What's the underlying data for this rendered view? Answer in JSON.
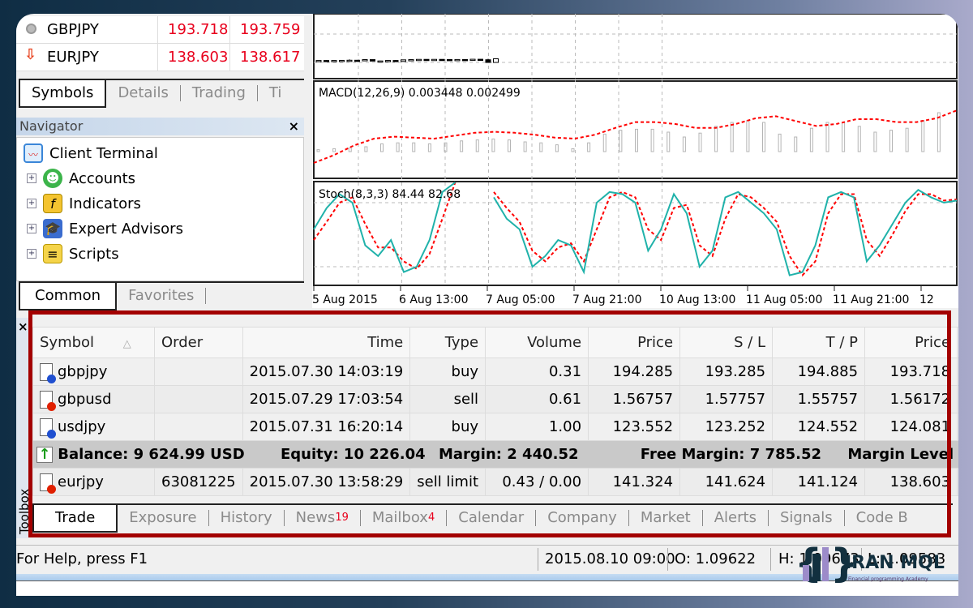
{
  "market_watch": {
    "rows": [
      {
        "symbol": "GBPJPY",
        "bid": "193.718",
        "ask": "193.759",
        "icon": "neutral-circle-icon"
      },
      {
        "symbol": "EURJPY",
        "bid": "138.603",
        "ask": "138.617",
        "icon": "down-arrow-icon"
      }
    ],
    "tabs": [
      "Symbols",
      "Details",
      "Trading",
      "Ti"
    ]
  },
  "navigator": {
    "title": "Navigator",
    "close": "×",
    "root": "Client Terminal",
    "items": [
      "Accounts",
      "Indicators",
      "Expert Advisors",
      "Scripts"
    ],
    "tabs": [
      "Common",
      "Favorites"
    ]
  },
  "chart": {
    "macd_label": "MACD(12,26,9) 0.003448 0.002499",
    "stoch_label": "Stoch(8,3,3) 84.44 82.68",
    "time_labels": [
      "5 Aug 2015",
      "6 Aug 13:00",
      "7 Aug 05:00",
      "7 Aug 21:00",
      "10 Aug 13:00",
      "11 Aug 05:00",
      "11 Aug 21:00",
      "12"
    ],
    "candles": [
      [
        1.0975,
        1.0977,
        1.0973,
        1.0976
      ],
      [
        1.0976,
        1.0978,
        1.0974,
        1.0975
      ],
      [
        1.0975,
        1.0977,
        1.0974,
        1.0976
      ],
      [
        1.0976,
        1.0979,
        1.0975,
        1.0977
      ],
      [
        1.0977,
        1.0985,
        1.0976,
        1.0978
      ],
      [
        1.0978,
        1.0979,
        1.0975,
        1.0977
      ],
      [
        1.0977,
        1.0984,
        1.0976,
        1.0983
      ],
      [
        1.0983,
        1.0984,
        1.097,
        1.0971
      ],
      [
        1.0971,
        1.0974,
        1.0969,
        1.0972
      ],
      [
        1.0972,
        1.0978,
        1.0971,
        1.0976
      ],
      [
        1.0976,
        1.0979,
        1.0967,
        1.0968
      ],
      [
        1.0968,
        1.0982,
        1.0967,
        1.0981
      ],
      [
        1.0981,
        1.0984,
        1.0979,
        1.0983
      ],
      [
        1.0983,
        1.0986,
        1.0981,
        1.0985
      ],
      [
        1.0985,
        1.0987,
        1.0983,
        1.0984
      ],
      [
        1.0984,
        1.0986,
        1.0982,
        1.0985
      ],
      [
        1.0985,
        1.0986,
        1.0983,
        1.0984
      ],
      [
        1.0984,
        1.0986,
        1.0981,
        1.0982
      ],
      [
        1.0982,
        1.0985,
        1.098,
        1.0984
      ],
      [
        1.0984,
        1.0986,
        1.0982,
        1.0983
      ],
      [
        1.0983,
        1.0987,
        1.0982,
        1.0986
      ],
      [
        1.0986,
        1.0987,
        1.0981,
        1.0982
      ],
      [
        1.0982,
        1.099,
        1.0958,
        1.096
      ],
      [
        1.096,
        1.0992,
        1.0959,
        1.099
      ]
    ],
    "macd_hist": [
      0.2,
      0.3,
      0.4,
      0.5,
      0.8,
      0.9,
      0.9,
      0.8,
      0.9,
      1.1,
      1.2,
      1.3,
      1.2,
      1.0,
      0.9,
      0.7,
      0.3,
      0.9,
      1.8,
      2.2,
      2.3,
      2.3,
      2.0,
      1.5,
      1.9,
      2.6,
      3.0,
      3.2,
      3.0,
      1.8,
      1.5,
      2.4,
      3.0,
      3.0,
      2.6,
      2.0,
      2.2,
      2.4,
      3.2,
      4.0
    ],
    "macd_signal": [
      -2.0,
      -1.2,
      -0.2,
      0.5,
      0.7,
      0.6,
      0.5,
      0.8,
      1.1,
      1.2,
      1.1,
      0.9,
      0.6,
      0.5,
      0.9,
      1.6,
      2.2,
      2.2,
      2.0,
      1.6,
      1.6,
      2.0,
      2.6,
      2.8,
      2.3,
      1.8,
      2.0,
      2.5,
      2.5,
      2.2,
      2.2,
      2.6,
      3.4
    ],
    "stoch_main": [
      55,
      75,
      88,
      80,
      40,
      30,
      45,
      15,
      20,
      45,
      90,
      110,
      null,
      null,
      85,
      65,
      55,
      20,
      30,
      45,
      40,
      15,
      80,
      90,
      88,
      80,
      35,
      55,
      88,
      70,
      20,
      35,
      85,
      90,
      80,
      70,
      55,
      12,
      15,
      40,
      85,
      90,
      85,
      25,
      40,
      60,
      80,
      92,
      85,
      80,
      82
    ],
    "stoch_signal": [
      45,
      62,
      80,
      85,
      60,
      38,
      38,
      25,
      18,
      32,
      65,
      100,
      null,
      null,
      90,
      75,
      62,
      35,
      25,
      38,
      42,
      25,
      55,
      85,
      90,
      85,
      55,
      45,
      75,
      78,
      40,
      30,
      65,
      88,
      85,
      75,
      62,
      30,
      12,
      25,
      70,
      88,
      88,
      45,
      30,
      50,
      72,
      88,
      88,
      82,
      83
    ],
    "colors": {
      "stoch_main": "#20b2aa",
      "signal": "#ff0000",
      "macd_hist": "#b4b4b4"
    }
  },
  "toolbox": {
    "label": "Toolbox",
    "close": "×",
    "columns": [
      "Symbol",
      "Order",
      "Time",
      "Type",
      "Volume",
      "Price",
      "S / L",
      "T / P",
      "Price"
    ],
    "rows": [
      {
        "symbol": "gbpjpy",
        "order": "",
        "time": "2015.07.30 14:03:19",
        "type": "buy",
        "volume": "0.31",
        "price": "194.285",
        "sl": "193.285",
        "tp": "194.885",
        "cur": "193.718",
        "dot": "#1f4fd0"
      },
      {
        "symbol": "gbpusd",
        "order": "",
        "time": "2015.07.29 17:03:54",
        "type": "sell",
        "volume": "0.61",
        "price": "1.56757",
        "sl": "1.57757",
        "tp": "1.55757",
        "cur": "1.56172",
        "dot": "#e02000"
      },
      {
        "symbol": "usdjpy",
        "order": "",
        "time": "2015.07.31 16:20:14",
        "type": "buy",
        "volume": "1.00",
        "price": "123.552",
        "sl": "123.252",
        "tp": "124.552",
        "cur": "124.081",
        "dot": "#1f4fd0"
      }
    ],
    "summary": {
      "balance": "Balance: 9 624.99 USD",
      "equity": "Equity: 10 226.04",
      "margin": "Margin: 2 440.52",
      "free_margin": "Free Margin: 7 785.52",
      "margin_level": "Margin Level ..."
    },
    "pending": {
      "symbol": "eurjpy",
      "order": "63081225",
      "time": "2015.07.30 13:58:29",
      "type": "sell limit",
      "volume": "0.43 / 0.00",
      "price": "141.324",
      "sl": "141.624",
      "tp": "141.124",
      "cur": "138.603",
      "dot": "#e02000"
    },
    "tabs": [
      {
        "label": "Trade"
      },
      {
        "label": "Exposure"
      },
      {
        "label": "History"
      },
      {
        "label": "News",
        "badge": "19"
      },
      {
        "label": "Mailbox",
        "badge": "4"
      },
      {
        "label": "Calendar"
      },
      {
        "label": "Company"
      },
      {
        "label": "Market"
      },
      {
        "label": "Alerts"
      },
      {
        "label": "Signals"
      },
      {
        "label": "Code B"
      }
    ]
  },
  "status": {
    "help": "For Help, press F1",
    "time": "2015.08.10 09:00",
    "open": "O: 1.09622",
    "high": "H: 1.09673",
    "low": "L: 1.09583"
  },
  "logo": {
    "name": "IRAN MQL",
    "tagline": "Financial programming Academy"
  },
  "accent": "#a30000"
}
